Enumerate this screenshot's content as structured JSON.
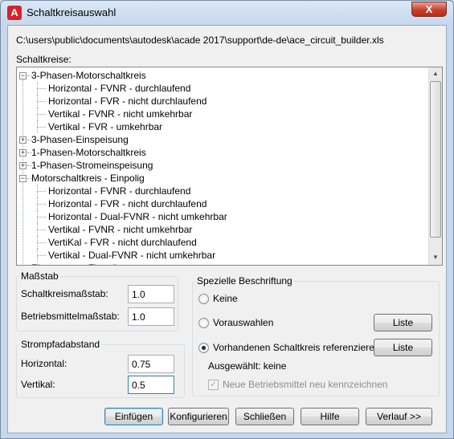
{
  "window": {
    "title": "Schaltkreisauswahl",
    "close_glyph": "X"
  },
  "file_path": "C:\\users\\public\\documents\\autodesk\\acade 2017\\support\\de-de\\ace_circuit_builder.xls",
  "circuits_label": "Schaltkreise:",
  "tree": [
    {
      "label": "3-Phasen-Motorschaltkreis",
      "level": 0,
      "expander": "−"
    },
    {
      "label": "Horizontal - FVNR - durchlaufend",
      "level": 1
    },
    {
      "label": "Horizontal - FVR - nicht durchlaufend",
      "level": 1
    },
    {
      "label": "Vertikal - FVNR - nicht umkehrbar",
      "level": 1
    },
    {
      "label": "Vertikal - FVR - umkehrbar",
      "level": 1
    },
    {
      "label": "3-Phasen-Einspeisung",
      "level": 0,
      "expander": "+"
    },
    {
      "label": "1-Phasen-Motorschaltkreis",
      "level": 0,
      "expander": "+"
    },
    {
      "label": "1-Phasen-Stromeinspeisung",
      "level": 0,
      "expander": "+"
    },
    {
      "label": "Motorschaltkreis - Einpolig",
      "level": 0,
      "expander": "−"
    },
    {
      "label": "Horizontal - FVNR - durchlaufend",
      "level": 1
    },
    {
      "label": "Horizontal - FVR - nicht durchlaufend",
      "level": 1
    },
    {
      "label": "Horizontal - Dual-FVNR - nicht umkehrbar",
      "level": 1
    },
    {
      "label": "Vertikal - FVNR - nicht umkehrbar",
      "level": 1
    },
    {
      "label": "VertiKal - FVR - nicht durchlaufend",
      "level": 1
    },
    {
      "label": "Vertikal - Dual-FVNR - nicht umkehrbar",
      "level": 1
    },
    {
      "label": "Elementares Einpolig",
      "level": 0,
      "expander": "+"
    }
  ],
  "scale": {
    "legend": "Maßstab",
    "circuit_scale_label": "Schaltkreismaßstab:",
    "circuit_scale_value": "1.0",
    "component_scale_label": "Betriebsmittelmaßstab:",
    "component_scale_value": "1.0"
  },
  "rung_spacing": {
    "legend": "Strompfadabstand",
    "horizontal_label": "Horizontal:",
    "horizontal_value": "0.75",
    "vertical_label": "Vertikal:",
    "vertical_value": "0.5"
  },
  "annotation": {
    "legend": "Spezielle Beschriftung",
    "option_none": "Keine",
    "option_preselect": "Vorauswahlen",
    "option_reference": "Vorhandenen Schaltkreis referenzieren",
    "list_button": "Liste",
    "selected_text": "Ausgewählt: keine",
    "checkbox_label": "Neue Betriebsmittel neu kennzeichnen",
    "selected_option": "reference"
  },
  "buttons": {
    "insert": "Einfügen",
    "configure": "Konfigurieren",
    "close": "Schließen",
    "help": "Hilfe",
    "history": "Verlauf >>"
  }
}
